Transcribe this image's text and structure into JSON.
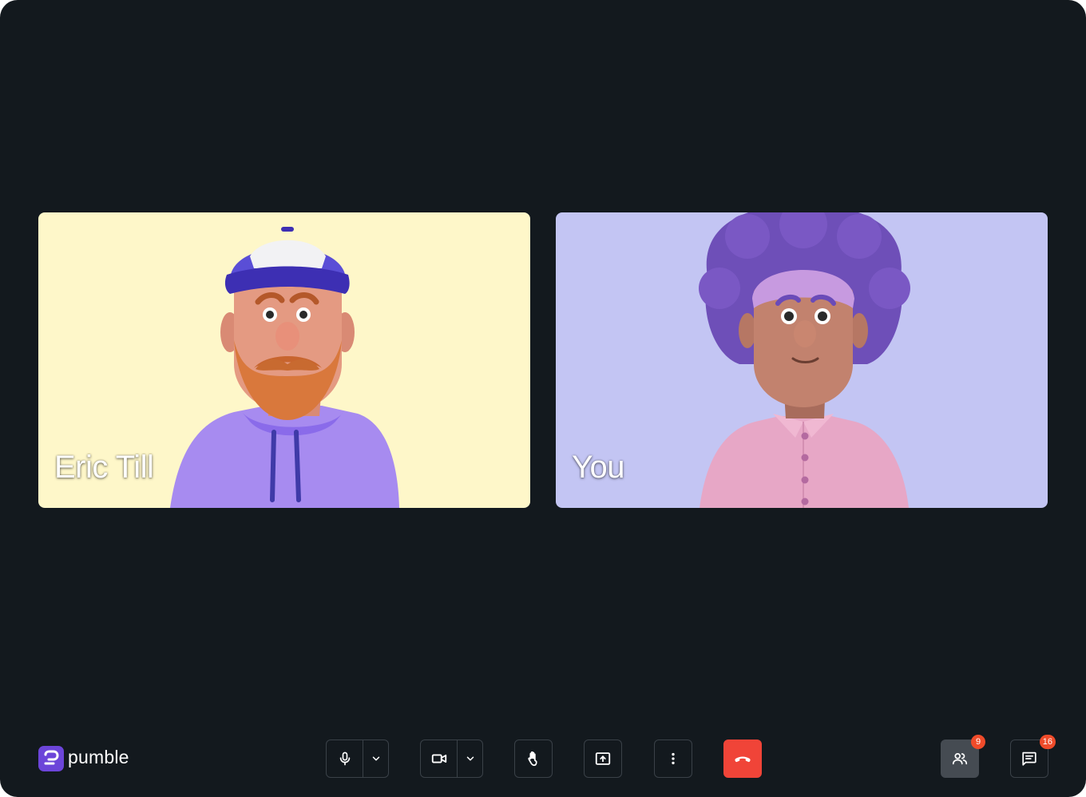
{
  "app": {
    "brand_name": "pumble",
    "brand_color": "#6c45d9",
    "background_color": "#13191e"
  },
  "participants": [
    {
      "name": "Eric Till",
      "tile_color": "#fef7c9",
      "avatar_icon": "avatar-bearded-man-cap"
    },
    {
      "name": "You",
      "tile_color": "#c3c5f3",
      "avatar_icon": "avatar-afro-pink-shirt"
    }
  ],
  "toolbar": {
    "mic_icon": "microphone-icon",
    "camera_icon": "video-camera-icon",
    "raise_hand_icon": "hand-icon",
    "share_screen_icon": "screen-share-icon",
    "more_icon": "more-vertical-icon",
    "hangup_icon": "phone-hangup-icon",
    "hangup_color": "#f04438",
    "participants_icon": "people-icon",
    "participants_count": "9",
    "chat_icon": "chat-icon",
    "chat_count": "16",
    "badge_color": "#ef4b2a"
  }
}
